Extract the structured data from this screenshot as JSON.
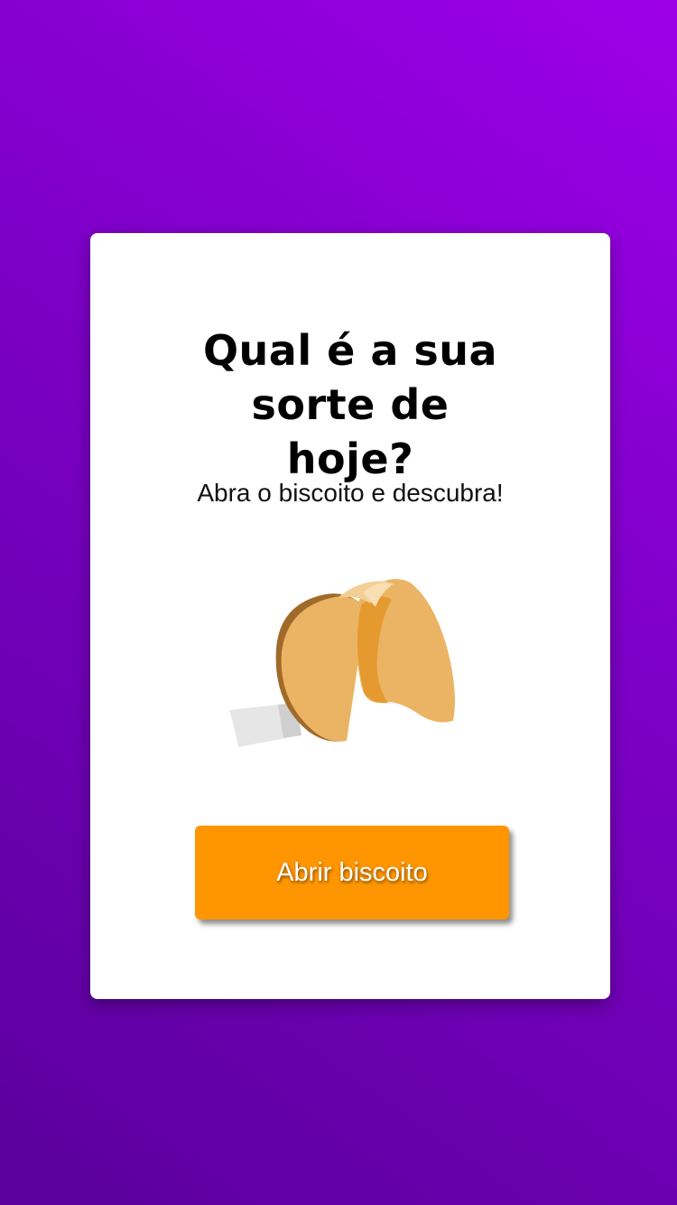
{
  "card": {
    "title": "Qual é a sua sorte de hoje?",
    "subtitle": "Abra o biscoito e descubra!",
    "illustration": "fortune-cookie-icon",
    "button_label": "Abrir biscoito"
  },
  "colors": {
    "background_top": "#9d00e8",
    "background_bottom": "#5a009c",
    "card": "#ffffff",
    "button": "#ff9500",
    "cookie": "#ebb464",
    "cookie_dark": "#e59a2f"
  }
}
